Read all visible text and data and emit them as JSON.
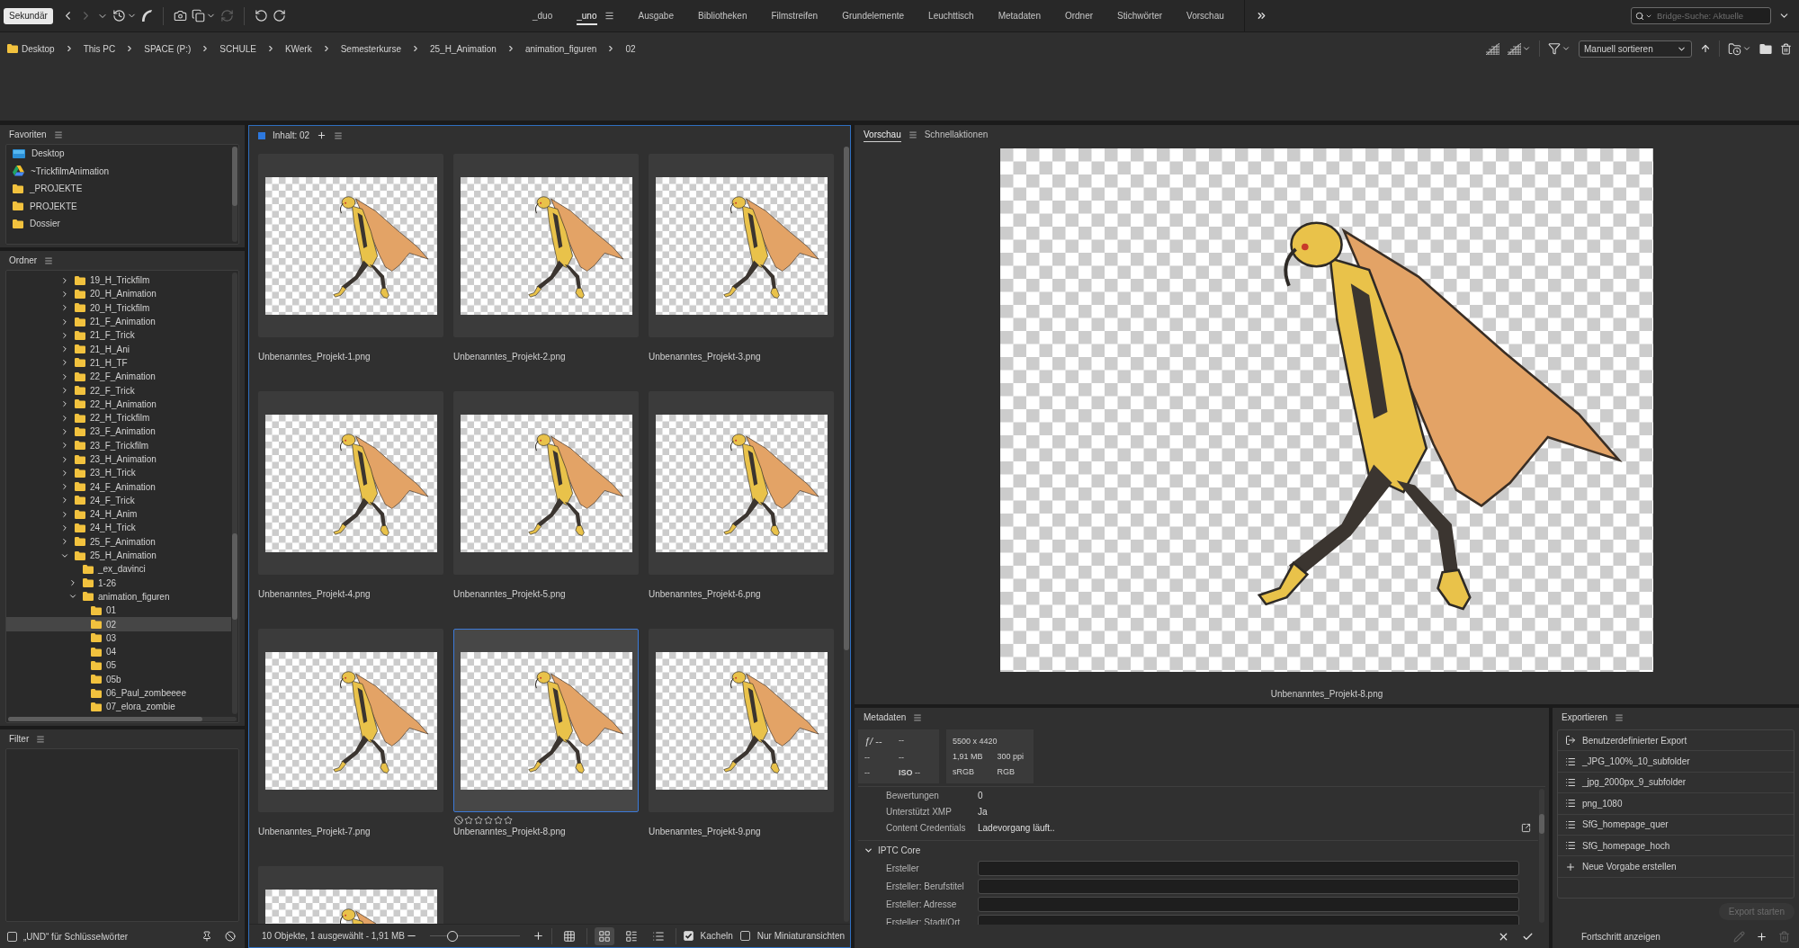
{
  "toolbar": {
    "mode_button": "Sekundär",
    "tools": [
      {
        "kind": "back",
        "disabled": false
      },
      {
        "kind": "forward",
        "disabled": true
      },
      {
        "kind": "recent",
        "disabled": false
      },
      {
        "kind": "history",
        "disabled": false
      },
      {
        "kind": "boomerang",
        "disabled": false
      },
      {
        "kind": "camera",
        "disabled": false
      },
      {
        "kind": "copy",
        "disabled": false
      },
      {
        "kind": "refresh",
        "disabled": true
      },
      {
        "kind": "rotate_left",
        "disabled": false
      },
      {
        "kind": "rotate_right",
        "disabled": false
      }
    ],
    "workspaces": [
      {
        "label": "_duo",
        "selected": false
      },
      {
        "label": "_uno",
        "selected": true
      },
      {
        "label": "Ausgabe",
        "selected": false
      },
      {
        "label": "Bibliotheken",
        "selected": false
      },
      {
        "label": "Filmstreifen",
        "selected": false
      },
      {
        "label": "Grundelemente",
        "selected": false
      },
      {
        "label": "Leuchttisch",
        "selected": false
      },
      {
        "label": "Metadaten",
        "selected": false
      },
      {
        "label": "Ordner",
        "selected": false
      },
      {
        "label": "Stichwörter",
        "selected": false
      },
      {
        "label": "Vorschau",
        "selected": false
      }
    ],
    "search": {
      "placeholder": "Bridge-Suche: Aktuelle"
    }
  },
  "path_bar": {
    "crumbs": [
      "Desktop",
      "This PC",
      "SPACE (P:)",
      "SCHULE",
      "KWerk",
      "Semesterkurse",
      "25_H_Animation",
      "animation_figuren",
      "02"
    ],
    "sort": "Manuell sortieren"
  },
  "favorites": {
    "title": "Favoriten",
    "items": [
      {
        "label": "Desktop",
        "kind": "desktop",
        "selected": false
      },
      {
        "label": "~TrickfilmAnimation",
        "kind": "drive",
        "selected": false
      },
      {
        "label": "_PROJEKTE",
        "kind": "folder",
        "selected": false
      },
      {
        "label": "PROJEKTE",
        "kind": "folder",
        "selected": false
      },
      {
        "label": "Dossier",
        "kind": "folder",
        "selected": false
      }
    ]
  },
  "folders": {
    "title": "Ordner",
    "items": [
      {
        "label": "19_H_Trickfilm",
        "expanded": false,
        "selected": false
      },
      {
        "label": "20_H_Animation",
        "expanded": false,
        "selected": false
      },
      {
        "label": "20_H_Trickfilm",
        "expanded": false,
        "selected": false
      },
      {
        "label": "21_F_Animation",
        "expanded": false,
        "selected": false
      },
      {
        "label": "21_F_Trick",
        "expanded": false,
        "selected": false
      },
      {
        "label": "21_H_Ani",
        "expanded": false,
        "selected": false
      },
      {
        "label": "21_H_TF",
        "expanded": false,
        "selected": false
      },
      {
        "label": "22_F_Animation",
        "expanded": false,
        "selected": false
      },
      {
        "label": "22_F_Trick",
        "expanded": false,
        "selected": false
      },
      {
        "label": "22_H_Animation",
        "expanded": false,
        "selected": false
      },
      {
        "label": "22_H_Trickfilm",
        "expanded": false,
        "selected": false
      },
      {
        "label": "23_F_Animation",
        "expanded": false,
        "selected": false
      },
      {
        "label": "23_F_Trickfilm",
        "expanded": false,
        "selected": false
      },
      {
        "label": "23_H_Animation",
        "expanded": false,
        "selected": false
      },
      {
        "label": "23_H_Trick",
        "expanded": false,
        "selected": false
      },
      {
        "label": "24_F_Animation",
        "expanded": false,
        "selected": false
      },
      {
        "label": "24_F_Trick",
        "expanded": false,
        "selected": false
      },
      {
        "label": "24_H_Anim",
        "expanded": false,
        "selected": false
      },
      {
        "label": "24_H_Trick",
        "expanded": false,
        "selected": false
      },
      {
        "label": "25_F_Animation",
        "expanded": false,
        "selected": false
      },
      {
        "label": "25_H_Animation",
        "expanded": true,
        "selected": false,
        "children": [
          {
            "label": "_ex_davinci",
            "selected": false
          },
          {
            "label": "1-26",
            "expanded": false,
            "selected": false
          },
          {
            "label": "animation_figuren",
            "expanded": true,
            "selected": false,
            "children": [
              {
                "label": "01",
                "selected": false
              },
              {
                "label": "02",
                "selected": true
              },
              {
                "label": "03",
                "selected": false
              },
              {
                "label": "04",
                "selected": false
              },
              {
                "label": "05",
                "selected": false
              },
              {
                "label": "05b",
                "selected": false
              },
              {
                "label": "06_Paul_zombeeee",
                "selected": false
              },
              {
                "label": "07_elora_zombie",
                "selected": false
              }
            ]
          }
        ]
      }
    ]
  },
  "filter": {
    "title": "Filter",
    "and_keywords": {
      "label": "„UND“ für Schlüsselwörter",
      "checked": false
    }
  },
  "content": {
    "title": "Inhalt: 02",
    "items": [
      {
        "label": "Unbenanntes_Projekt-1.png",
        "selected": false
      },
      {
        "label": "Unbenanntes_Projekt-2.png",
        "selected": false
      },
      {
        "label": "Unbenanntes_Projekt-3.png",
        "selected": false
      },
      {
        "label": "Unbenanntes_Projekt-4.png",
        "selected": false
      },
      {
        "label": "Unbenanntes_Projekt-5.png",
        "selected": false
      },
      {
        "label": "Unbenanntes_Projekt-6.png",
        "selected": false
      },
      {
        "label": "Unbenanntes_Projekt-7.png",
        "selected": false
      },
      {
        "label": "Unbenanntes_Projekt-8.png",
        "selected": true,
        "stars": 0
      },
      {
        "label": "Unbenanntes_Projekt-9.png",
        "selected": false
      },
      {
        "selected": false
      }
    ],
    "status": "10 Objekte, 1 ausgewählt - 1,91 MB",
    "zoom": {
      "level": 0.25
    },
    "views": [
      {
        "kind": "grid",
        "selected": false
      },
      {
        "kind": "tiles",
        "selected": true
      },
      {
        "kind": "details",
        "selected": false
      },
      {
        "kind": "list",
        "selected": false
      }
    ],
    "tiles": {
      "label": "Kacheln",
      "checked": true
    },
    "thumbnails_only": {
      "label": "Nur Miniaturansichten",
      "checked": false
    }
  },
  "preview": {
    "tabs": [
      {
        "label": "Vorschau",
        "selected": true
      },
      {
        "label": "Schnellaktionen",
        "selected": false
      }
    ],
    "caption": "Unbenanntes_Projekt-8.png"
  },
  "metadata": {
    "title": "Metadaten",
    "camera": [
      [
        "*ƒ/* --",
        "--"
      ],
      [
        "--",
        "--"
      ],
      [
        "--",
        "**ISO** --"
      ]
    ],
    "file_info": [
      [
        "5500 x 4420"
      ],
      [
        "1,91 MB",
        "300 ppi"
      ],
      [
        "sRGB",
        "RGB"
      ]
    ],
    "properties": [
      {
        "label": "Bewertungen",
        "value": "0"
      },
      {
        "label": "Unterstützt XMP",
        "value": "Ja"
      },
      {
        "label": "Content Credentials",
        "value": "Ladevorgang läuft.."
      }
    ],
    "section": {
      "title": "IPTC Core",
      "expanded": true,
      "fields": [
        {
          "label": "Ersteller"
        },
        {
          "label": "Ersteller: Berufstitel"
        },
        {
          "label": "Ersteller: Adresse"
        },
        {
          "label": "Ersteller: Stadt/Ort"
        }
      ]
    }
  },
  "export": {
    "title": "Exportieren",
    "items": [
      {
        "kind": "custom",
        "label": "Benutzerdefinierter Export"
      },
      {
        "kind": "preset",
        "label": "_JPG_100%_10_subfolder"
      },
      {
        "kind": "preset",
        "label": "_jpg_2000px_9_subfolder"
      },
      {
        "kind": "preset",
        "label": "png_1080"
      },
      {
        "kind": "preset",
        "label": "SfG_homepage_quer"
      },
      {
        "kind": "preset",
        "label": "SfG_homepage_hoch"
      },
      {
        "kind": "add",
        "label": "Neue Vorgabe erstellen"
      }
    ],
    "start_button": {
      "label": "Export starten",
      "disabled": true
    },
    "progress": "Fortschritt anzeigen",
    "actions": [
      {
        "kind": "edit",
        "disabled": true
      },
      {
        "kind": "add",
        "disabled": false
      },
      {
        "kind": "delete",
        "disabled": true
      }
    ]
  }
}
